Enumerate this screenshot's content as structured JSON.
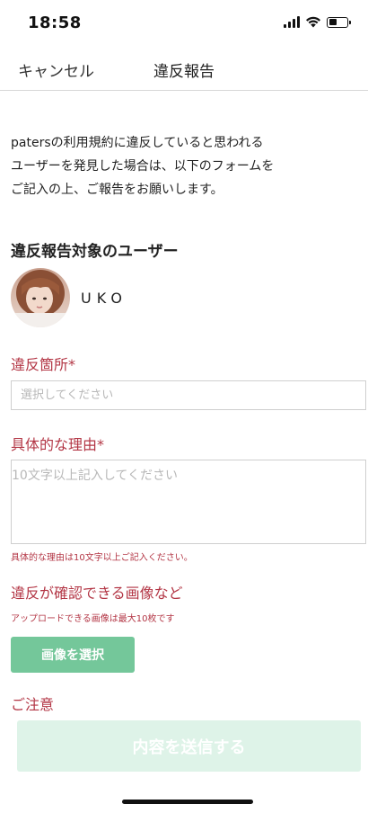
{
  "status_bar": {
    "time": "18:58",
    "signal_level": 4,
    "battery_level": 0.45
  },
  "nav": {
    "cancel_label": "キャンセル",
    "title": "違反報告"
  },
  "intro": {
    "lines": [
      "patersの利用規約に違反していると思われる",
      "ユーザーを発見した場合は、以下のフォームを",
      "ご記入の上、ご報告をお願いします。"
    ]
  },
  "target_user": {
    "section_title": "違反報告対象のユーザー",
    "name": "UKO"
  },
  "location_field": {
    "label": "違反箇所",
    "required_mark": "*",
    "placeholder": "選択してください"
  },
  "reason_field": {
    "label": "具体的な理由",
    "required_mark": "*",
    "placeholder": "10文字以上記入してください",
    "hint": "具体的な理由は10文字以上ご記入ください。"
  },
  "images": {
    "label": "違反が確認できる画像など",
    "hint": "アップロードできる画像は最大10枚です",
    "select_button_label": "画像を選択"
  },
  "notice": {
    "label": "ご注意"
  },
  "submit_button_label": "内容を送信する",
  "colors": {
    "accent_red": "#b33645",
    "button_green": "#74c79a",
    "submit_disabled": "#def3e8"
  }
}
